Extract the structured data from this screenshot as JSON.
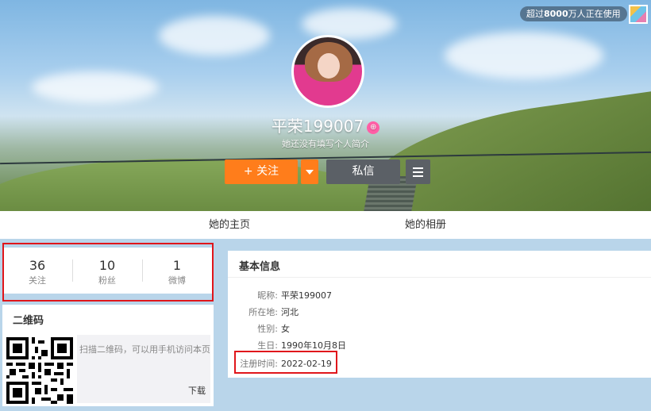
{
  "header": {
    "usage_badge_prefix": "超过",
    "usage_badge_count": "8000",
    "usage_badge_suffix": "万人正在使用"
  },
  "profile": {
    "nickname": "平荣199007",
    "bio": "她还没有填写个人简介",
    "vip_icon_glyph": "⊕"
  },
  "actions": {
    "follow_label": "+ 关注",
    "message_label": "私信"
  },
  "tabs": [
    {
      "label": "她的主页"
    },
    {
      "label": "她的相册"
    }
  ],
  "stats": [
    {
      "count": "36",
      "label": "关注"
    },
    {
      "count": "10",
      "label": "粉丝"
    },
    {
      "count": "1",
      "label": "微博"
    }
  ],
  "qr": {
    "title": "二维码",
    "description": "扫描二维码，可以用手机访问本页",
    "download_label": "下载"
  },
  "info": {
    "title": "基本信息",
    "rows": [
      {
        "key": "昵称:",
        "value": "平荣199007"
      },
      {
        "key": "所在地:",
        "value": "河北"
      },
      {
        "key": "性别:",
        "value": "女"
      },
      {
        "key": "生日:",
        "value": "1990年10月8日"
      },
      {
        "key": "注册时间:",
        "value": "2022-02-19"
      }
    ]
  },
  "colors": {
    "accent": "#ff7d1b",
    "secondary_button": "#5b6066",
    "highlight": "#e0161b",
    "page_background": "#b9d5ea"
  }
}
